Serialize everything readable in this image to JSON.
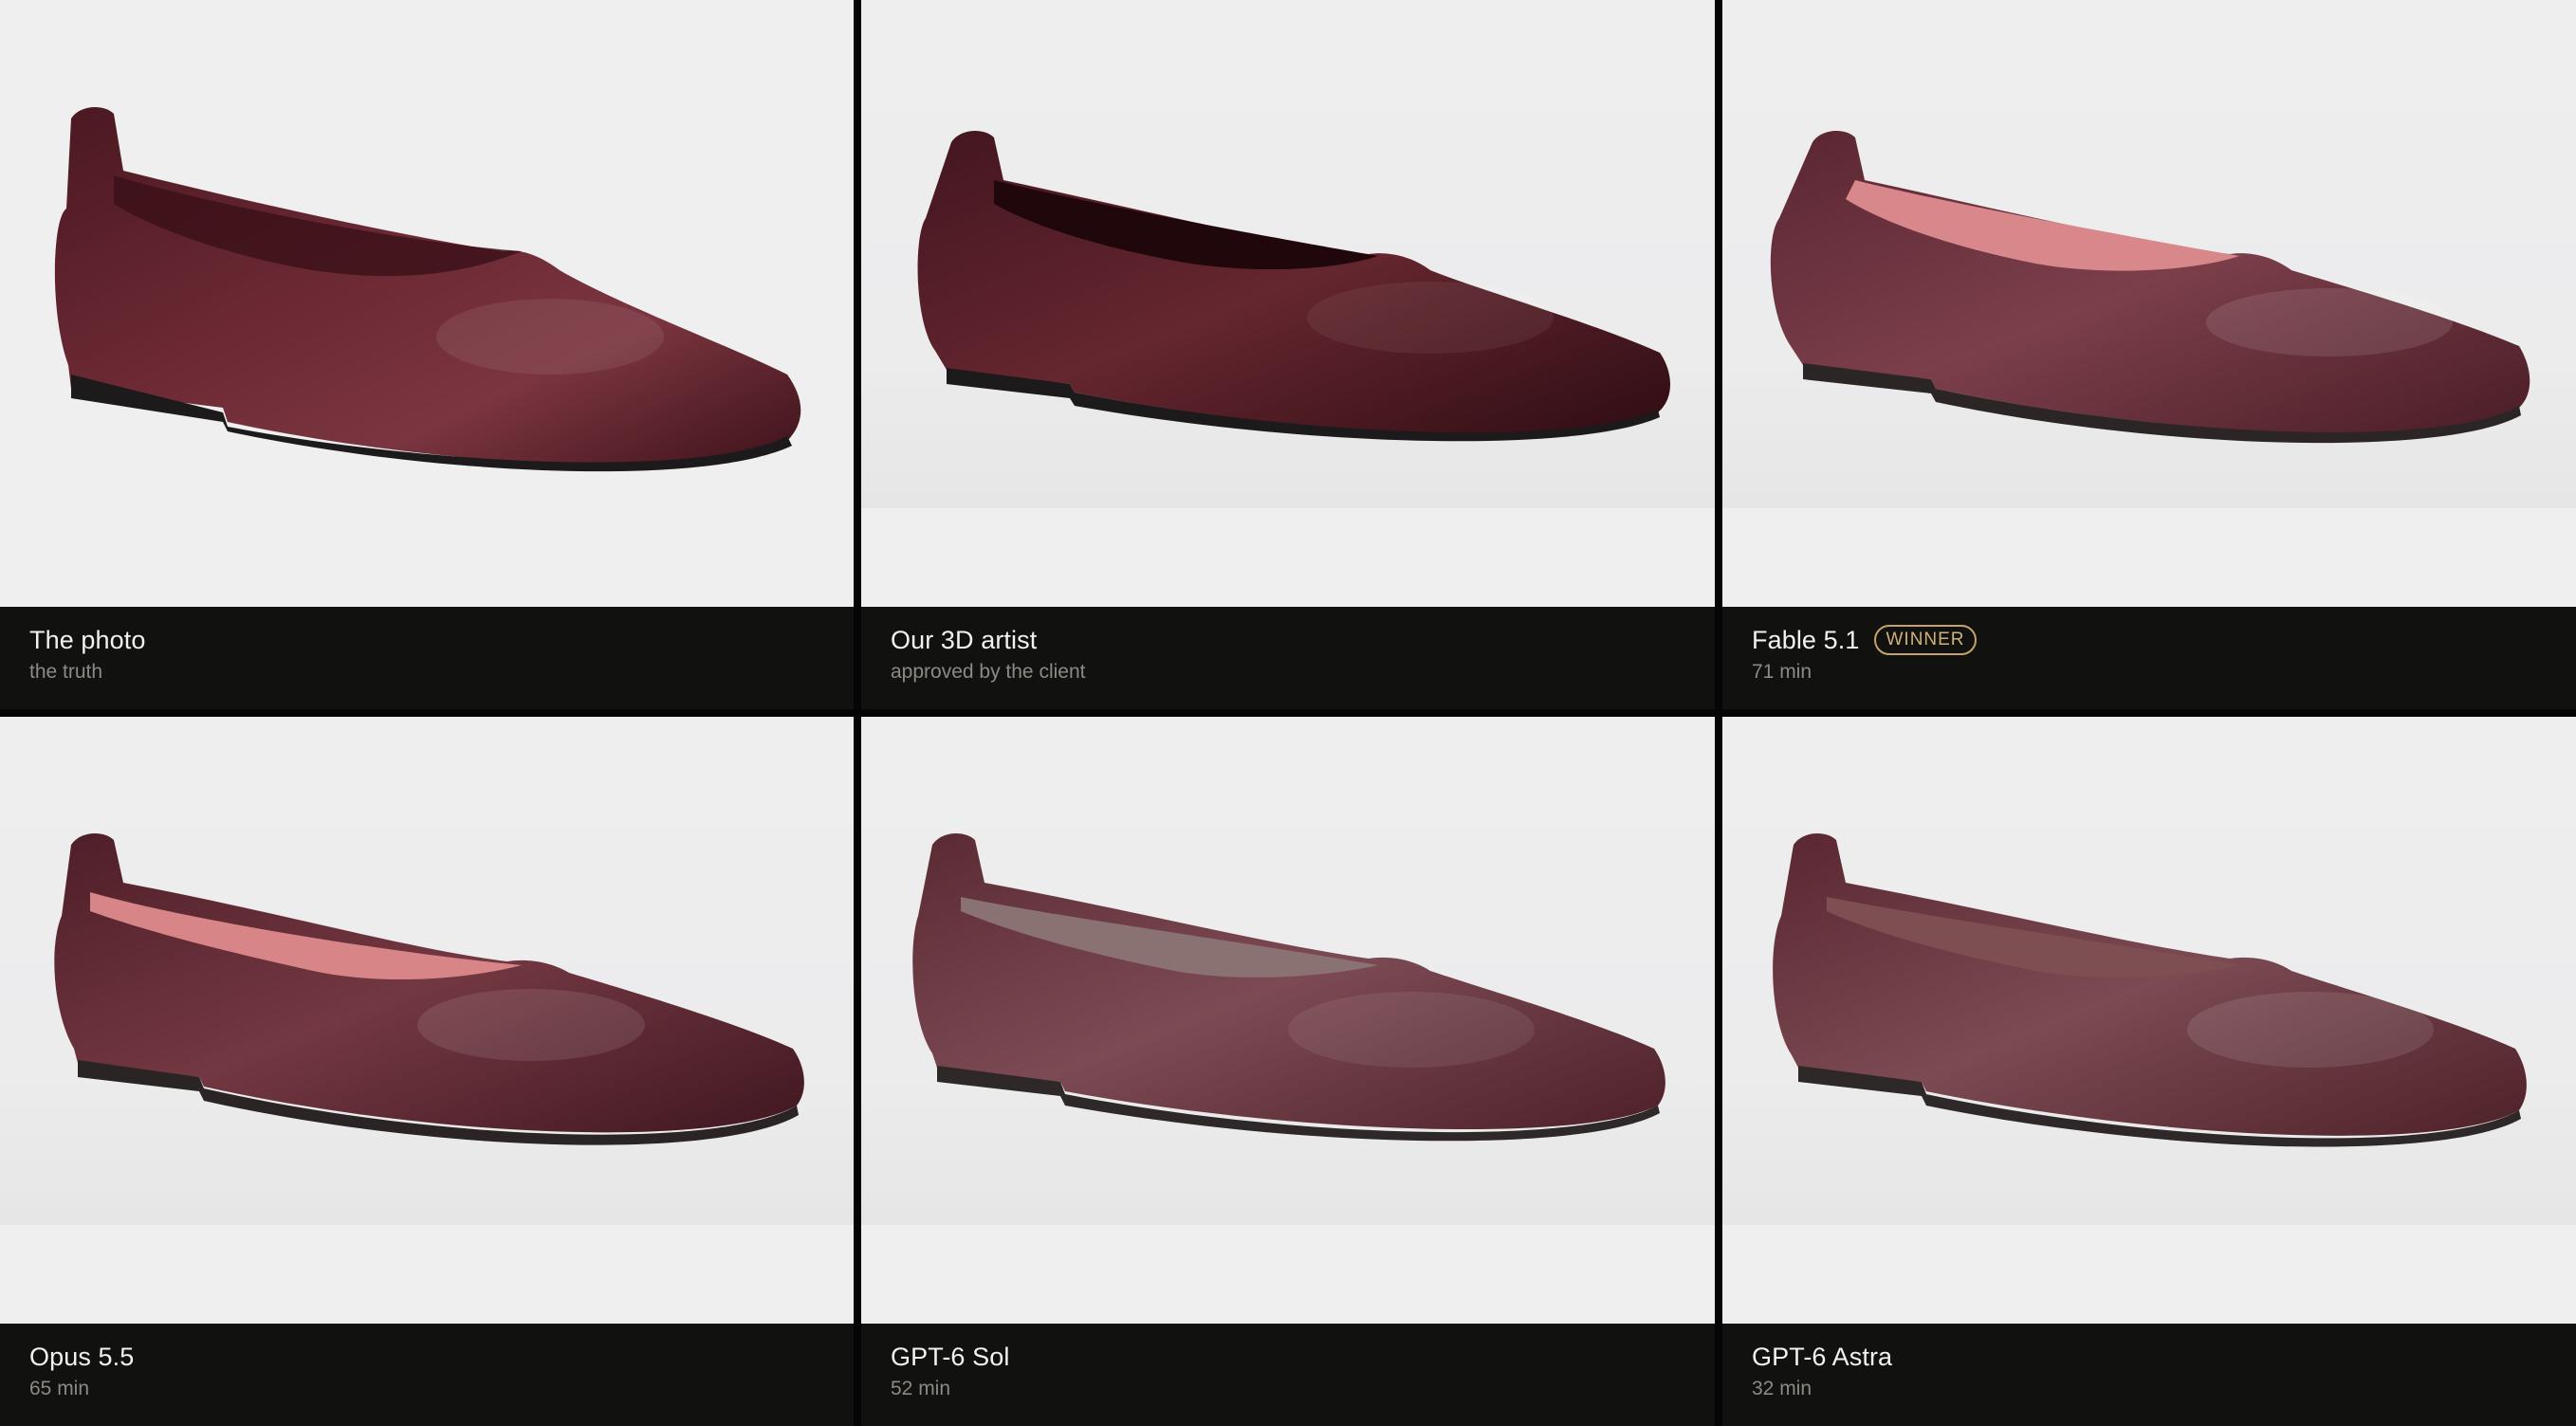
{
  "cards": [
    {
      "title": "The photo",
      "subtitle": "the truth"
    },
    {
      "title": "Our 3D artist",
      "subtitle": "approved by the client"
    },
    {
      "title": "Fable 5.1",
      "subtitle": "71 min",
      "badge": "WINNER"
    },
    {
      "title": "Opus 5.5",
      "subtitle": "65 min"
    },
    {
      "title": "GPT-6 Sol",
      "subtitle": "52 min"
    },
    {
      "title": "GPT-6 Astra",
      "subtitle": "32 min"
    }
  ],
  "colors": {
    "background": "#0f0f0e",
    "image_background": "#efeff0",
    "caption_background": "#111110",
    "title_text": "#f3f2ee",
    "subtitle_text": "#8d8a84",
    "badge_accent": "#c4a36d",
    "shoe_burgundy": "#5a1f2a",
    "shoe_lining_pink": "#d98a8d",
    "shoe_sole": "#1b1a1a"
  },
  "icons": [
    "shoe-image"
  ]
}
